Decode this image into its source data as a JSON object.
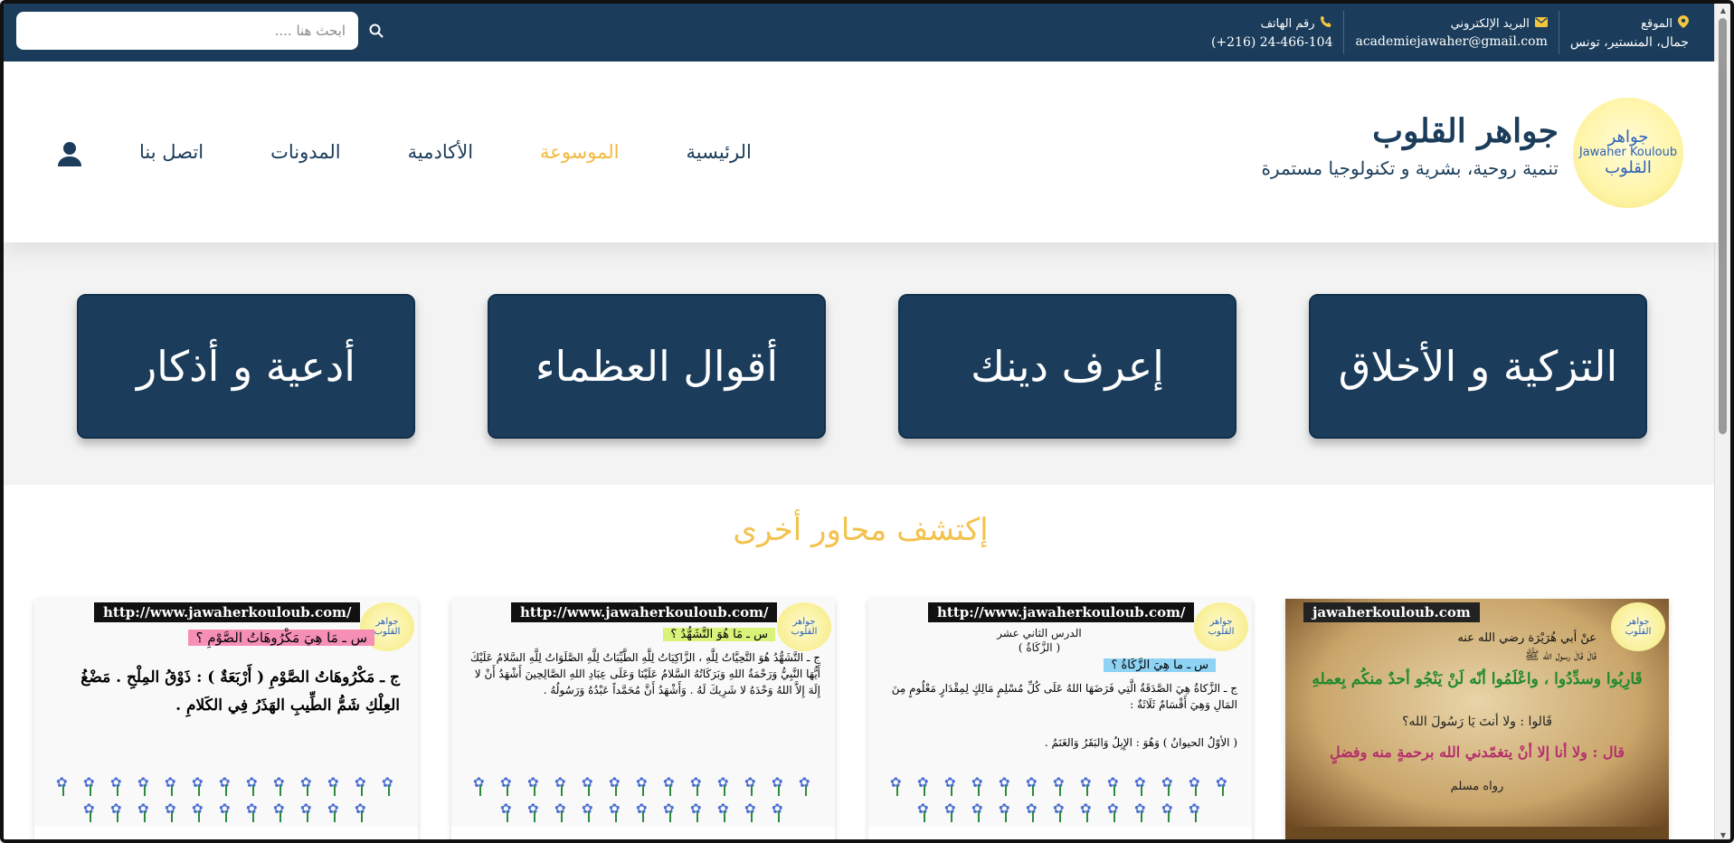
{
  "topbar": {
    "search_placeholder": "ابحث هنا ....",
    "location_label": "الموقع",
    "location_value": "جمال، المنستير، تونس",
    "email_label": "البريد الإلكتروني",
    "email_value": "academiejawaher@gmail.com",
    "phone_label": "رقم الهاتف",
    "phone_value": "(+216) 24-466-104"
  },
  "header": {
    "logo_top": "جواهر",
    "logo_middle": "Jawaher Kouloub",
    "logo_bottom": "القلوب",
    "title": "جواهر القلوب",
    "subtitle": "تنمية روحية، بشرية و تكنولوجيا مستمرة"
  },
  "nav": {
    "items": [
      {
        "label": "الرئيسية"
      },
      {
        "label": "الموسوعة"
      },
      {
        "label": "الأكادمية"
      },
      {
        "label": "المدونات"
      },
      {
        "label": "اتصل بنا"
      }
    ]
  },
  "categories": [
    {
      "label": "التزكية و الأخلاق"
    },
    {
      "label": "إعرف دينك"
    },
    {
      "label": "أقوال العظماء"
    },
    {
      "label": "أدعية و أذكار"
    }
  ],
  "discover": {
    "title": "إكتشف محاور أخرى"
  },
  "cards": [
    {
      "url": "jawaherkouloub.com",
      "line1": "عنْ أبي هُرَيْرَة رضي الله عنه",
      "line2": "قَالَ قَالَ رسول الله ﷺ",
      "line3": "قَارِبُوا وسدِّدُوا ، واعْلَمُوا أنّه لَنْ يَنْجُو أحدٌ منكُم بِعملهِ",
      "line4": "قَالوا : ولا أنتَ يَا رَسُولَ الله؟",
      "line5": "قال : ولا أنا إلا أنْ يتغمّدني الله برحمةٍ منه وفضلٍ",
      "line6": "رواه مسلم"
    },
    {
      "url": "http://www.jawaherkouloub.com/",
      "line1": "الدرس الثاني عشر",
      "line2": "( الزَّكَاةُ )",
      "line3": "س ـ ما هِيَ الزَّكَاةُ ؟",
      "line4": "ج ـ الزَّكاةُ هِيَ الصَّدَقَةُ الَّتِي فَرَضَهَا اللهُ عَلَى كُلِّ مُسْلِمٍ مَالِكٍ لِمِقْدَارٍ مَعْلُومٍ مِنَ المَالِ وَهِيَ أَقْسَامٌ ثَلَاثَةٌ :",
      "line5": "( الأوّلُ الحيوانُ ) وَهُوَ : الإِبِلُ وَالبَقَرُ وَالغَنَمُ ."
    },
    {
      "url": "http://www.jawaherkouloub.com/",
      "line1": "س ـ مَا هُوَ التَّشَهُّدُ ؟",
      "line2": "ج ـ التَّشَهُّدُ هُوَ التَّحِيَّاتُ لِلَّهِ ، الزَّاكِيَاتُ لِلَّهِ الطَّيِّبَاتُ لِلَّهِ الصَّلَوَاتُ لِلَّهِ السَّلامُ عَلَيْكَ أَيُّهَا النَّبِيُّ وَرَحْمَةُ اللهِ وَبَرَكَاتُهُ السَّلامُ عَلَيْنَا وَعَلَى عِبَادِ اللهِ الصَّالِحِينَ أَشْهَدُ أَنْ لا إِلَهَ إِلاَّ اللهُ وَحْدَهُ لا شَرِيكَ لَهُ . وَأَشْهَدُ أَنَّ مُحَمَّداً عَبْدُهُ وَرَسُولُهُ ."
    },
    {
      "url": "http://www.jawaherkouloub.com/",
      "line1": "س ـ مَا هِيَ مَكْرُوهَاتُ الصَّوْمِ ؟",
      "line2": "ج ـ مَكْرُوهَاتُ الصَّوْمِ ( أَرْبَعَةٌ ) : ذَوْقُ المِلْحِ . مَضْغُ العِلْكِ شَمُّ الطِّيبِ الهَذَرُ فِي الكَلامِ ."
    }
  ],
  "colors": {
    "navy": "#1b3d5b",
    "gold": "#f3b93d"
  }
}
